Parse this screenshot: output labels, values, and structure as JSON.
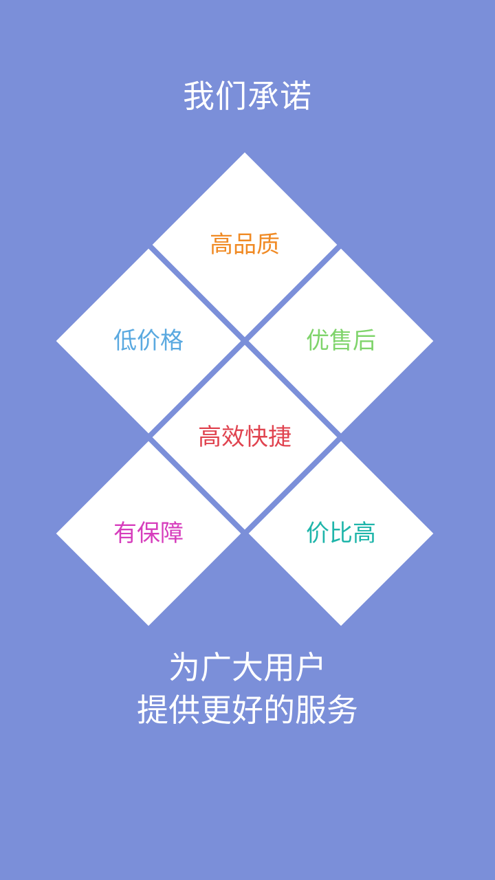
{
  "page": {
    "title": "我们承诺",
    "background_color": "#7b8fd9"
  },
  "promises": [
    {
      "label": "高品质",
      "color": "#f08a24"
    },
    {
      "label": "低价格",
      "color": "#5aa9e0"
    },
    {
      "label": "优售后",
      "color": "#7fd46b"
    },
    {
      "label": "高效快捷",
      "color": "#e0434f"
    },
    {
      "label": "有保障",
      "color": "#d63dbc"
    },
    {
      "label": "价比高",
      "color": "#1fb5aa"
    }
  ],
  "footer": {
    "line1": "为广大用户",
    "line2": "提供更好的服务"
  }
}
